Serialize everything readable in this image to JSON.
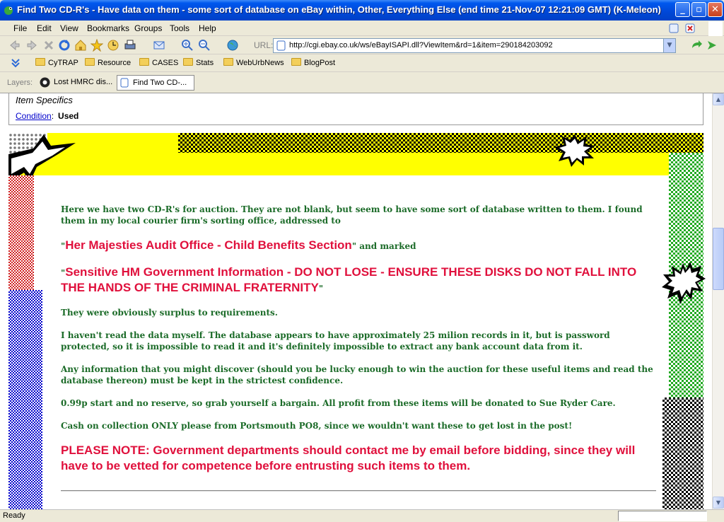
{
  "window": {
    "title": "Find Two CD-R's - Have data on them - some sort of database on eBay within, Other, Everything Else (end time 21-Nov-07 12:21:09 GMT) (K-Meleon)"
  },
  "menu": {
    "items": [
      "File",
      "Edit",
      "View",
      "Bookmarks",
      "Groups",
      "Tools",
      "Help"
    ]
  },
  "navbar": {
    "url_label": "URL:",
    "url": "http://cgi.ebay.co.uk/ws/eBayISAPI.dll?ViewItem&rd=1&item=290184203092"
  },
  "bookmarks": {
    "items": [
      "CyTRAP",
      "Resource",
      "CASES",
      "Stats",
      "WebUrbNews",
      "BlogPost"
    ]
  },
  "layers": {
    "label": "Layers:",
    "tabs": [
      "Lost HMRC dis...",
      "Find Two CD-..."
    ]
  },
  "item_specifics": {
    "header": "Item Specifics",
    "condition_label": "Condition",
    "condition_sep": ":",
    "condition_value": "Used"
  },
  "description": {
    "p1": "Here we have two CD-R's for auction. They are not blank, but seem to have some sort of database written to them. I found them in my local courier firm's sorting office, addressed to",
    "addressed_quote_open": "\"",
    "addressed_to": "Her Majesties Audit Office - Child Benefits Section",
    "addressed_quote_close": "\"",
    "and_marked": " and marked",
    "marked_quote_open": "\"",
    "marked": "Sensitive HM Government Information - DO NOT LOSE - ENSURE THESE DISKS DO NOT FALL INTO THE HANDS OF THE CRIMINAL FRATERNITY",
    "marked_quote_close": "\"",
    "p3": "They were obviously surplus to requirements.",
    "p4": "I haven't read the data myself. The database appears to have approximately 25 milion records in it, but is password protected, so it is impossible to read it and it's definitely impossible to extract any bank account data from it.",
    "p5": "Any information that you might discover (should you be lucky enough to win the auction for these useful items and read the database thereon) must be kept in the strictest confidence.",
    "p6": "0.99p start and no reserve, so grab yourself a bargain. All profit from these items will be donated to Sue Ryder Care.",
    "p7": "Cash on collection ONLY please from Portsmouth PO8, since we wouldn't want these to get lost in the post!",
    "note": "PLEASE NOTE: Government departments should contact me by email before bidding, since they will have to be vetted for competence  before entrusting such items to them."
  },
  "status": {
    "text": "Ready"
  },
  "colors": {
    "green_text": "#1b6b28",
    "red_text": "#e0103c",
    "link": "#0000cc",
    "title_bar": "#0047d6"
  }
}
